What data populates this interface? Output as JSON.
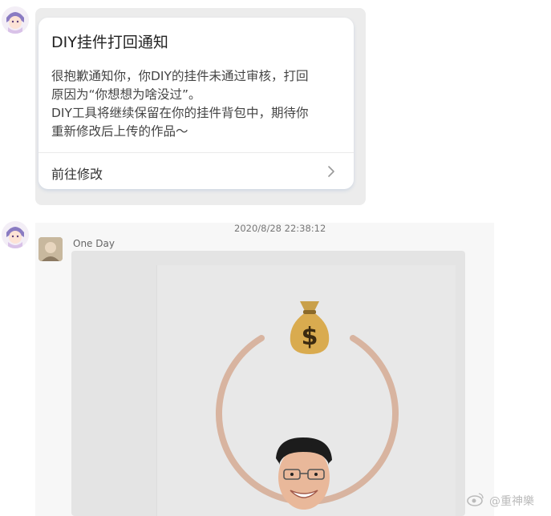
{
  "notification_card": {
    "title": "DIY挂件打回通知",
    "body_lines": [
      "很抱歉通知你，你DIY的挂件未通过审核，打回",
      "原因为“你想想为啥没过”。",
      "DIY工具将继续保留在你的挂件背包中，期待你",
      "重新修改后上传的作品～"
    ],
    "action_label": "前往修改"
  },
  "chat": {
    "timestamp": "2020/8/28 22:38:12",
    "sender_name": "One Day"
  },
  "icons": {
    "money_bag": "money-bag-emoji",
    "chevron": "chevron-right-icon"
  },
  "watermark": {
    "text": "@重神樂"
  },
  "colors": {
    "ring": "#d8b4a0",
    "card_bg": "#ffffff",
    "chat_bg": "#f7f7f7"
  }
}
